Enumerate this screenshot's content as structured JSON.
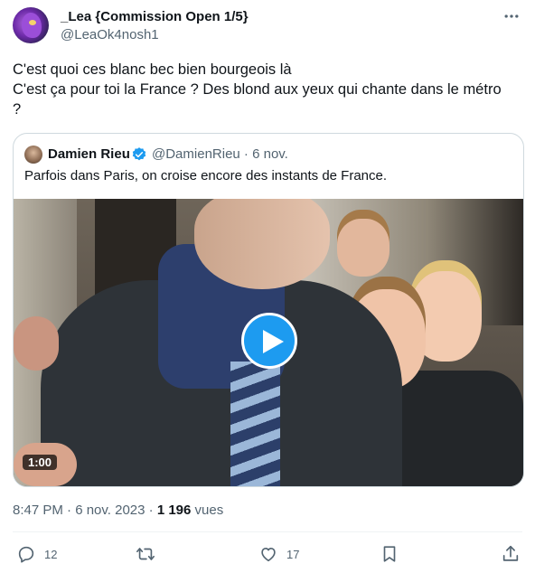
{
  "author": {
    "display_name": "_Lea {Commission Open 1/5}",
    "handle": "@LeaOk4nosh1"
  },
  "tweet": {
    "lines": [
      "C'est quoi ces blanc bec bien bourgeois là",
      "C'est ça pour toi la France ? Des blond aux yeux qui chante dans le métro",
      "?"
    ]
  },
  "quoted": {
    "display_name": "Damien Rieu",
    "handle_date": "@DamienRieu · 6 nov.",
    "text": "Parfois dans Paris, on croise encore des instants de France.",
    "video_duration": "1:00"
  },
  "meta": {
    "time_date": "8:47 PM · 6 nov. 2023 · ",
    "views_count": "1 196",
    "views_label": " vues"
  },
  "actions": {
    "replies": "12",
    "likes": "17"
  },
  "colors": {
    "accent": "#1d9bf0",
    "text": "#0f1419",
    "secondary": "#536471",
    "border": "#cfd9de"
  }
}
